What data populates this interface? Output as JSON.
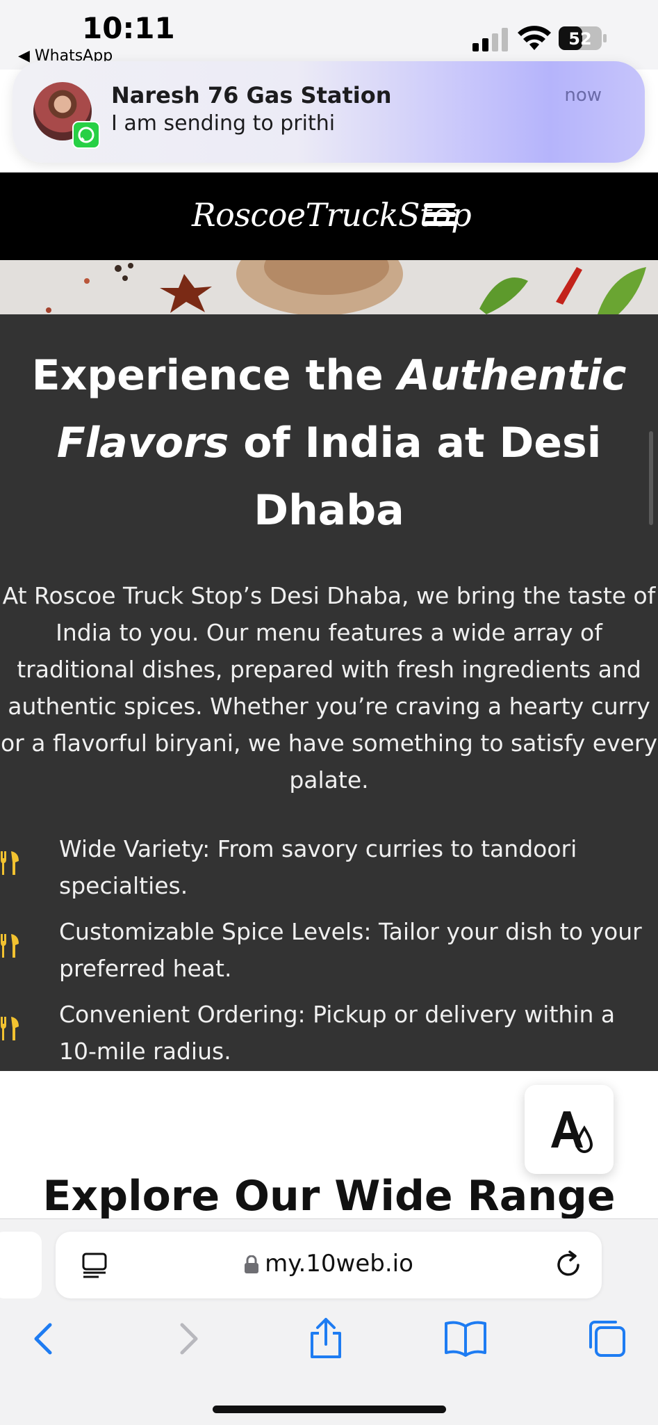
{
  "status_bar": {
    "time": "10:11",
    "back_app": "◀ WhatsApp",
    "battery": "52"
  },
  "notification": {
    "sender": "Naresh 76 Gas Station",
    "message": "I am sending to prithi",
    "time": "now",
    "app_icon": "whatsapp-icon"
  },
  "site": {
    "logo": "RoscoeTruckStop",
    "hero_title_parts": [
      "Experience the ",
      "Authentic Flavors",
      " of India at Desi Dhaba"
    ],
    "intro": "At Roscoe Truck Stop’s Desi Dhaba, we bring the taste of India to you. Our menu features a wide array of traditional dishes, prepared with fresh ingredients and authentic spices. Whether you’re craving a hearty curry or a flavorful biryani, we have something to satisfy every palate.",
    "features": [
      "Wide Variety: From savory curries to tandoori specialties.",
      "Customizable Spice Levels: Tailor your dish to your preferred heat.",
      "Convenient Ordering: Pickup or delivery within a 10-mile radius."
    ],
    "feature_icon": "utensils-icon",
    "accent_color": "#f2c230",
    "next_heading": "Explore Our Wide Range"
  },
  "browser": {
    "url": "my.10web.io"
  }
}
